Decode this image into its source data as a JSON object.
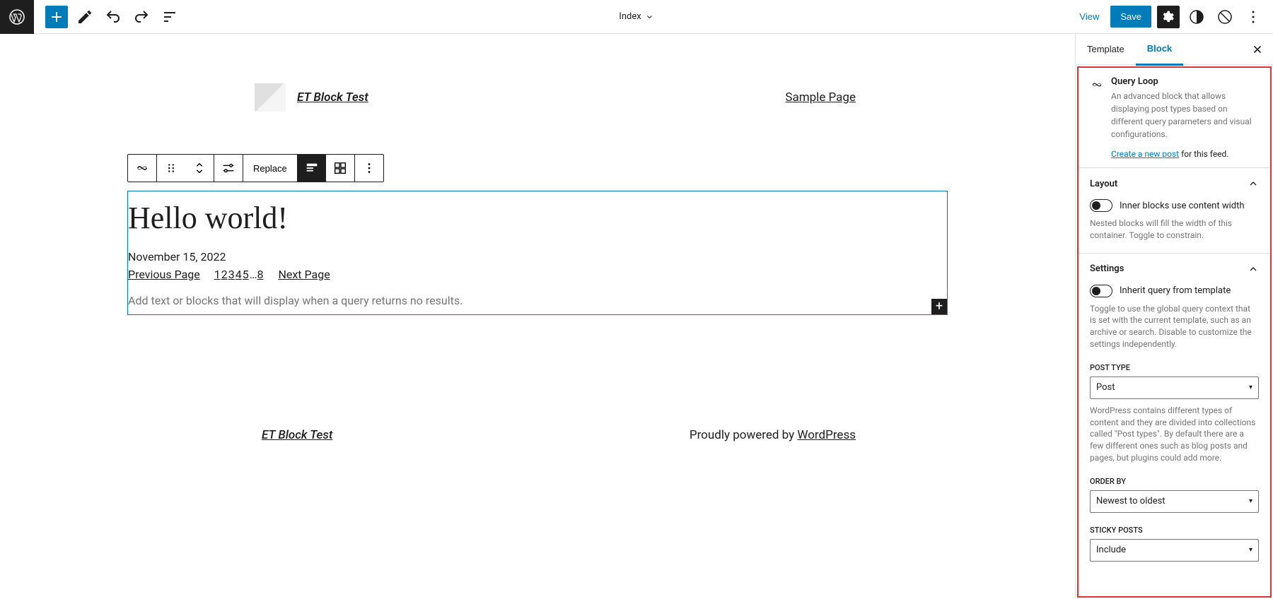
{
  "topbar": {
    "template_name": "Index",
    "view": "View",
    "save": "Save"
  },
  "canvas": {
    "site_title": "ET Block Test",
    "nav_link": "Sample Page",
    "post_title": "Hello world!",
    "post_date": "November 15, 2022",
    "prev_page": "Previous Page",
    "next_page": "Next Page",
    "page_numbers": [
      "1",
      "2",
      "3",
      "4",
      "5",
      "…",
      "8"
    ],
    "no_results": "Add text or blocks that will display when a query returns no results.",
    "toolbar_replace": "Replace",
    "footer_left": "ET Block Test",
    "footer_text": "Proudly powered by ",
    "footer_link": "WordPress"
  },
  "sidebar": {
    "tabs": {
      "template": "Template",
      "block": "Block"
    },
    "block": {
      "name": "Query Loop",
      "desc": "An advanced block that allows displaying post types based on different query parameters and visual configurations.",
      "new_post_link": "Create a new post",
      "new_post_suffix": " for this feed."
    },
    "layout": {
      "title": "Layout",
      "toggle_label": "Inner blocks use content width",
      "help": "Nested blocks will fill the width of this container. Toggle to constrain."
    },
    "settings": {
      "title": "Settings",
      "inherit_label": "Inherit query from template",
      "inherit_help": "Toggle to use the global query context that is set with the current template, such as an archive or search. Disable to customize the settings independently.",
      "post_type_label": "POST TYPE",
      "post_type_value": "Post",
      "post_type_help": "WordPress contains different types of content and they are divided into collections called \"Post types\". By default there are a few different ones such as blog posts and pages, but plugins could add more.",
      "order_by_label": "ORDER BY",
      "order_by_value": "Newest to oldest",
      "sticky_label": "STICKY POSTS",
      "sticky_value": "Include"
    }
  }
}
